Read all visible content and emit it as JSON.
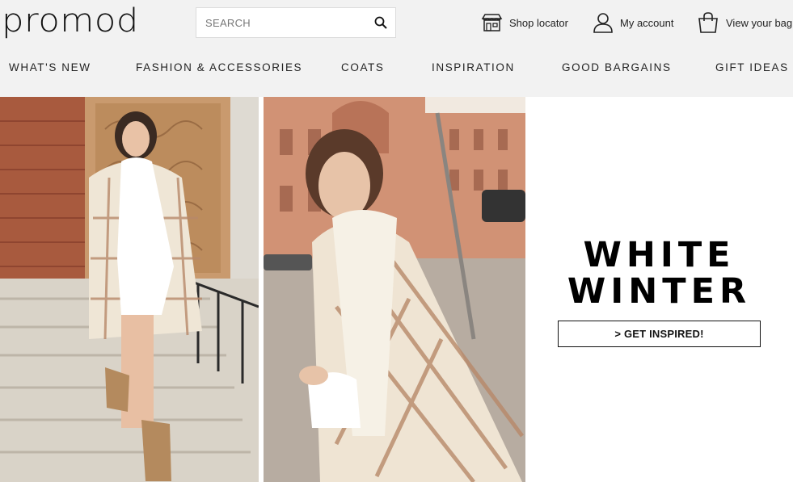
{
  "header": {
    "logo_text": "promod",
    "search": {
      "placeholder": "SEARCH",
      "icon": "search-icon"
    },
    "utilities": [
      {
        "label": "Shop locator",
        "icon": "store-icon"
      },
      {
        "label": "My account",
        "icon": "user-icon"
      },
      {
        "label": "View your bag",
        "icon": "shopping-bag-icon"
      }
    ]
  },
  "nav": {
    "items": [
      {
        "label": "WHAT'S NEW"
      },
      {
        "label": "FASHION & ACCESSORIES"
      },
      {
        "label": "COATS"
      },
      {
        "label": "INSPIRATION"
      },
      {
        "label": "GOOD BARGAINS"
      },
      {
        "label": "GIFT IDEAS"
      }
    ]
  },
  "hero": {
    "headline_line1": "WHITE",
    "headline_line2": "WINTER",
    "cta_label": "> GET INSPIRED!",
    "colors": {
      "brick": "#b0583a",
      "stone": "#d8d2c8",
      "coat_cream": "#efe6d6",
      "plaid": "#b8896a"
    }
  }
}
